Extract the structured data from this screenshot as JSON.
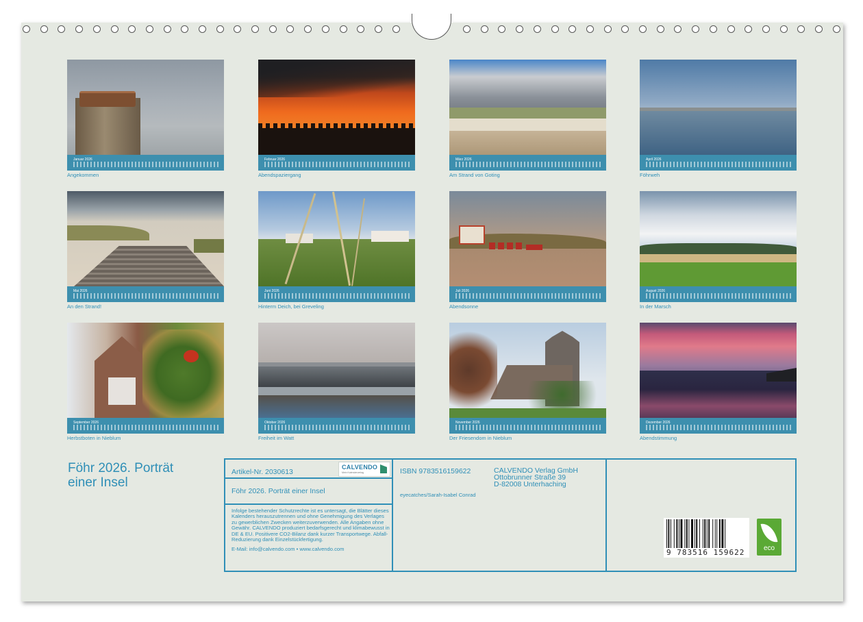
{
  "months": [
    {
      "month": "Januar 2026",
      "caption": "Angekommen"
    },
    {
      "month": "Februar 2026",
      "caption": "Abendspaziergang"
    },
    {
      "month": "März 2026",
      "caption": "Am Strand von Goting"
    },
    {
      "month": "April 2026",
      "caption": "Föhrweh"
    },
    {
      "month": "Mai 2026",
      "caption": "An den Strand!"
    },
    {
      "month": "Juni 2026",
      "caption": "Hinterm Deich, bei Greveling"
    },
    {
      "month": "Juli 2026",
      "caption": "Abendsonne"
    },
    {
      "month": "August 2026",
      "caption": "In der Marsch"
    },
    {
      "month": "September 2026",
      "caption": "Herbstboten in Nieblum"
    },
    {
      "month": "Oktober 2026",
      "caption": "Freiheit im Watt"
    },
    {
      "month": "November 2026",
      "caption": "Der Friesendom in Nieblum"
    },
    {
      "month": "Dezember 2026",
      "caption": "Abendstimmung"
    }
  ],
  "cover": {
    "title_line1": "Föhr 2026. Porträt",
    "title_line2": "einer Insel"
  },
  "info": {
    "article_no": "Artikel-Nr. 2030613",
    "logo_word": "CALVENDO",
    "logo_sub": "Mein Kalenderverlag",
    "title": "Föhr 2026. Porträt einer Insel",
    "legal": "Infolge bestehender Schutzrechte ist es untersagt, die Blätter dieses Kalenders herauszutrennen und ohne Genehmigung des Verlages zu gewerblichen Zwecken weiterzuverwenden. Alle Angaben ohne Gewähr. CALVENDO produziert bedarfsgerecht und klimabewusst in DE & EU. Positivere CO2-Bilanz dank kurzer Transportwege. Abfall-Reduzierung dank Einzelstückfertigung.",
    "email": "E-Mail: info@calvendo.com • www.calvendo.com",
    "isbn": "ISBN 9783516159622",
    "author": "eyecatches/Sarah-Isabel Conrad",
    "publisher_line1": "CALVENDO Verlag GmbH",
    "publisher_line2": "Ottobrunner Straße 39",
    "publisher_line3": "D-82008 Unterhaching",
    "barcode_number": "9 783516 159622",
    "eco_label": "eco"
  }
}
